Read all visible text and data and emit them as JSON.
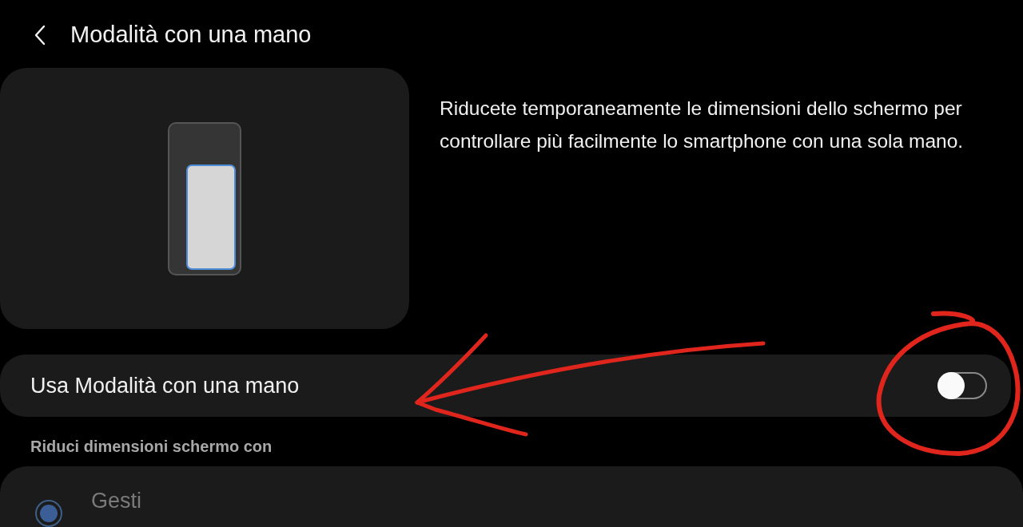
{
  "header": {
    "title": "Modalità con una mano"
  },
  "intro": {
    "description": "Riducete temporaneamente le dimensioni dello schermo per controllare più facilmente lo smartphone con una sola mano."
  },
  "main_toggle": {
    "label": "Usa Modalità con una mano",
    "on": false
  },
  "section": {
    "label": "Riduci dimensioni schermo con"
  },
  "options": [
    {
      "label": "Gesti",
      "selected": true,
      "disabled": true
    }
  ]
}
